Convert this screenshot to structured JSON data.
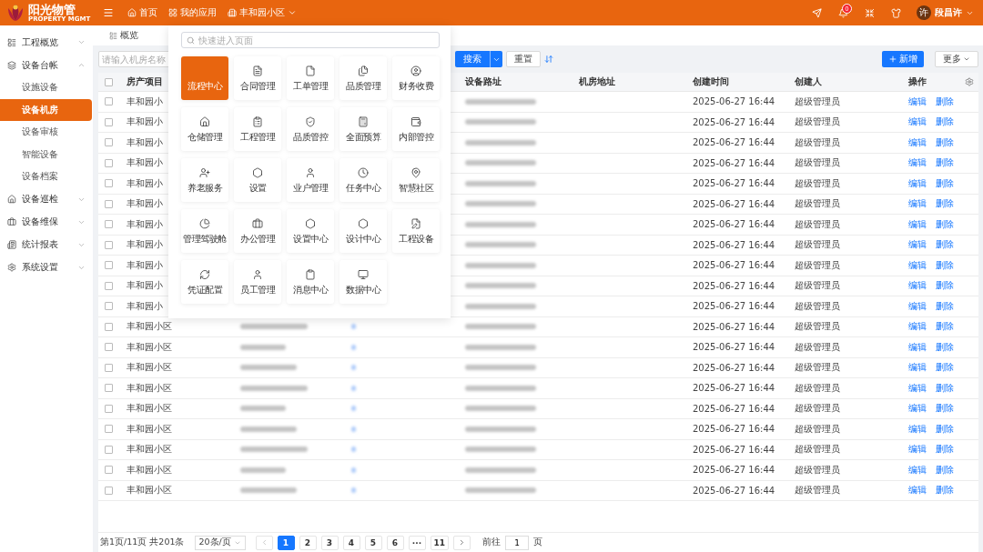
{
  "brand": {
    "name": "阳光物管",
    "tagline": "PROPERTY MGMT"
  },
  "topnav": [
    {
      "label": "首页",
      "kind": "home"
    },
    {
      "label": "我的应用",
      "kind": "apps"
    },
    {
      "label": "丰和园小区",
      "kind": "estate"
    }
  ],
  "notifications": {
    "count": "0"
  },
  "user": {
    "avatar": "许",
    "name": "段昌许"
  },
  "sidebar": {
    "items": [
      {
        "label": "工程概览",
        "expanded": false
      },
      {
        "label": "设备台帐",
        "expanded": true,
        "children": [
          {
            "label": "设施设备",
            "selected": false
          },
          {
            "label": "设备机房",
            "selected": true
          },
          {
            "label": "设备审核",
            "selected": false
          },
          {
            "label": "智能设备",
            "selected": false
          },
          {
            "label": "设备档案",
            "selected": false
          }
        ]
      },
      {
        "label": "设备巡检",
        "expanded": false
      },
      {
        "label": "设备维保",
        "expanded": false
      },
      {
        "label": "统计报表",
        "expanded": false
      },
      {
        "label": "系统设置",
        "expanded": false
      }
    ]
  },
  "page_tab": "概览",
  "filter": {
    "placeholder": "请输入机房名称",
    "search": "搜索",
    "reset": "重置",
    "add": "新增",
    "more": "更多"
  },
  "app_menu": {
    "placeholder": "快速进入页面",
    "tiles": [
      {
        "label": "流程中心",
        "selected": true
      },
      {
        "label": "合同管理",
        "selected": false
      },
      {
        "label": "工单管理",
        "selected": false
      },
      {
        "label": "品质管理",
        "selected": false
      },
      {
        "label": "财务收费",
        "selected": false
      },
      {
        "label": "仓储管理",
        "selected": false
      },
      {
        "label": "工程管理",
        "selected": false
      },
      {
        "label": "品质管控",
        "selected": false
      },
      {
        "label": "全面预算",
        "selected": false
      },
      {
        "label": "内部管控",
        "selected": false
      },
      {
        "label": "养老服务",
        "selected": false
      },
      {
        "label": "设置",
        "selected": false
      },
      {
        "label": "业户管理",
        "selected": false
      },
      {
        "label": "任务中心",
        "selected": false
      },
      {
        "label": "智慧社区",
        "selected": false
      },
      {
        "label": "管理驾驶舱",
        "selected": false
      },
      {
        "label": "办公管理",
        "selected": false
      },
      {
        "label": "设置中心",
        "selected": false
      },
      {
        "label": "设计中心",
        "selected": false
      },
      {
        "label": "工程设备",
        "selected": false
      },
      {
        "label": "凭证配置",
        "selected": false
      },
      {
        "label": "员工管理",
        "selected": false
      },
      {
        "label": "消息中心",
        "selected": false
      },
      {
        "label": "数据中心",
        "selected": false
      }
    ]
  },
  "table": {
    "all_checked": false,
    "columns": [
      "房产项目",
      "设备路址",
      "机房地址",
      "创建时间",
      "创建人",
      "操作"
    ],
    "rows": [
      {
        "kind": "covered",
        "checked": false,
        "property": "丰和园小",
        "created": "2025-06-27 16:44",
        "creator": "超级管理员",
        "actions": [
          "编辑",
          "删除"
        ]
      },
      {
        "kind": "covered",
        "checked": false,
        "property": "丰和园小",
        "created": "2025-06-27 16:44",
        "creator": "超级管理员",
        "actions": [
          "编辑",
          "删除"
        ]
      },
      {
        "kind": "covered",
        "checked": false,
        "property": "丰和园小",
        "created": "2025-06-27 16:44",
        "creator": "超级管理员",
        "actions": [
          "编辑",
          "删除"
        ]
      },
      {
        "kind": "covered",
        "checked": false,
        "property": "丰和园小",
        "created": "2025-06-27 16:44",
        "creator": "超级管理员",
        "actions": [
          "编辑",
          "删除"
        ]
      },
      {
        "kind": "covered",
        "checked": false,
        "property": "丰和园小",
        "created": "2025-06-27 16:44",
        "creator": "超级管理员",
        "actions": [
          "编辑",
          "删除"
        ]
      },
      {
        "kind": "covered",
        "checked": false,
        "property": "丰和园小",
        "created": "2025-06-27 16:44",
        "creator": "超级管理员",
        "actions": [
          "编辑",
          "删除"
        ]
      },
      {
        "kind": "covered",
        "checked": false,
        "property": "丰和园小",
        "created": "2025-06-27 16:44",
        "creator": "超级管理员",
        "actions": [
          "编辑",
          "删除"
        ]
      },
      {
        "kind": "covered",
        "checked": false,
        "property": "丰和园小",
        "created": "2025-06-27 16:44",
        "creator": "超级管理员",
        "actions": [
          "编辑",
          "删除"
        ]
      },
      {
        "kind": "covered",
        "checked": false,
        "property": "丰和园小",
        "created": "2025-06-27 16:44",
        "creator": "超级管理员",
        "actions": [
          "编辑",
          "删除"
        ]
      },
      {
        "kind": "covered",
        "checked": false,
        "property": "丰和园小",
        "created": "2025-06-27 16:44",
        "creator": "超级管理员",
        "actions": [
          "编辑",
          "删除"
        ]
      },
      {
        "kind": "covered",
        "checked": false,
        "property": "丰和园小",
        "created": "2025-06-27 16:44",
        "creator": "超级管理员",
        "actions": [
          "编辑",
          "删除"
        ]
      },
      {
        "kind": "open",
        "checked": false,
        "property": "丰和园小区",
        "created": "2025-06-27 16:44",
        "creator": "超级管理员",
        "actions": [
          "编辑",
          "删除"
        ]
      },
      {
        "kind": "open",
        "checked": false,
        "property": "丰和园小区",
        "created": "2025-06-27 16:44",
        "creator": "超级管理员",
        "actions": [
          "编辑",
          "删除"
        ]
      },
      {
        "kind": "open",
        "checked": false,
        "property": "丰和园小区",
        "created": "2025-06-27 16:44",
        "creator": "超级管理员",
        "actions": [
          "编辑",
          "删除"
        ]
      },
      {
        "kind": "open",
        "checked": false,
        "property": "丰和园小区",
        "created": "2025-06-27 16:44",
        "creator": "超级管理员",
        "actions": [
          "编辑",
          "删除"
        ]
      },
      {
        "kind": "open",
        "checked": false,
        "property": "丰和园小区",
        "created": "2025-06-27 16:44",
        "creator": "超级管理员",
        "actions": [
          "编辑",
          "删除"
        ]
      },
      {
        "kind": "open",
        "checked": false,
        "property": "丰和园小区",
        "created": "2025-06-27 16:44",
        "creator": "超级管理员",
        "actions": [
          "编辑",
          "删除"
        ]
      },
      {
        "kind": "open",
        "checked": false,
        "property": "丰和园小区",
        "created": "2025-06-27 16:44",
        "creator": "超级管理员",
        "actions": [
          "编辑",
          "删除"
        ]
      },
      {
        "kind": "open",
        "checked": false,
        "property": "丰和园小区",
        "created": "2025-06-27 16:44",
        "creator": "超级管理员",
        "actions": [
          "编辑",
          "删除"
        ]
      },
      {
        "kind": "open",
        "checked": false,
        "property": "丰和园小区",
        "created": "2025-06-27 16:44",
        "creator": "超级管理员",
        "actions": [
          "编辑",
          "删除"
        ]
      }
    ]
  },
  "pagination": {
    "summary": "第1页/11页 共201条",
    "page_size": "20条/页",
    "pages": [
      {
        "label": "1",
        "selected": true
      },
      {
        "label": "2",
        "selected": false
      },
      {
        "label": "3",
        "selected": false
      },
      {
        "label": "4",
        "selected": false
      },
      {
        "label": "5",
        "selected": false
      },
      {
        "label": "6",
        "selected": false
      },
      {
        "label": "···",
        "selected": false
      },
      {
        "label": "11",
        "selected": false
      }
    ],
    "goto_label": "前往",
    "goto_value": "1",
    "goto_suffix": "页"
  }
}
